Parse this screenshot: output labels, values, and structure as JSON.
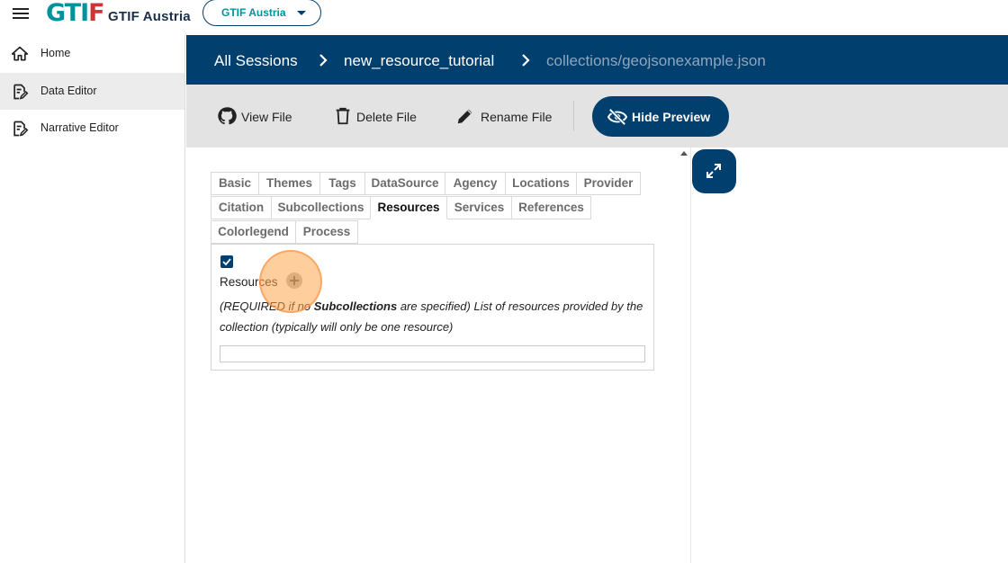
{
  "header": {
    "logo_mark": "GTIF",
    "logo_text": "GTIF Austria",
    "brand_select_value": "GTIF Austria"
  },
  "sidebar": {
    "items": [
      {
        "label": "Home",
        "icon": "home-icon"
      },
      {
        "label": "Data Editor",
        "icon": "edit-document-icon",
        "active": true
      },
      {
        "label": "Narrative Editor",
        "icon": "edit-document-icon"
      }
    ]
  },
  "breadcrumb": {
    "items": [
      "All Sessions",
      "new_resource_tutorial",
      "collections/geojsonexample.json"
    ]
  },
  "toolbar": {
    "view_file": "View File",
    "delete_file": "Delete File",
    "rename_file": "Rename File",
    "hide_preview": "Hide Preview"
  },
  "tabs": {
    "row1": [
      "Basic",
      "Themes",
      "Tags",
      "DataSource",
      "Agency",
      "Locations",
      "Provider"
    ],
    "row2": [
      "Citation",
      "Subcollections",
      "Resources",
      "Services",
      "References"
    ],
    "row3": [
      "Colorlegend",
      "Process"
    ],
    "active": "Resources"
  },
  "form": {
    "checked": true,
    "field_label": "Resources",
    "desc_prefix": "(REQUIRED if no ",
    "desc_bold": "Subcollections",
    "desc_suffix": " are specified) List of resources provided by the collection (typically will only be one resource)",
    "input_value": ""
  },
  "colors": {
    "primary": "#003f6e",
    "logo_teal": "#00929c",
    "logo_red": "#d0343a",
    "toolbar_bg": "#e3e3e3"
  }
}
